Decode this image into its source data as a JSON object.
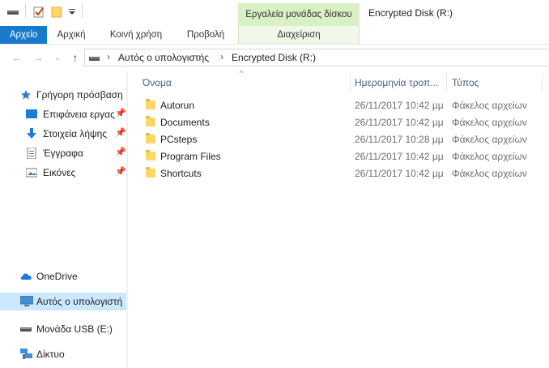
{
  "window": {
    "title": "Encrypted Disk (R:)",
    "contextual_tab_group": "Εργαλεία μονάδας δίσκου",
    "contextual_tab": "Διαχείριση"
  },
  "ribbon": {
    "tabs": [
      "Αρχείο",
      "Αρχική",
      "Κοινή χρήση",
      "Προβολή"
    ]
  },
  "address": {
    "breadcrumbs": [
      "Αυτός ο υπολογιστής",
      "Encrypted Disk (R:)"
    ],
    "separator": "›"
  },
  "nav_buttons": {
    "back": "←",
    "forward": "→",
    "recent": "⌄",
    "up": "↑"
  },
  "navigation": {
    "quick_access": {
      "label": "Γρήγορη πρόσβαση",
      "icon": "star-icon"
    },
    "pinned": [
      {
        "label": "Επιφάνεια εργας",
        "icon": "desktop-icon",
        "pin": "📌"
      },
      {
        "label": "Στοιχεία λήψης",
        "icon": "download-icon",
        "pin": "📌"
      },
      {
        "label": "Έγγραφα",
        "icon": "documents-icon",
        "pin": "📌"
      },
      {
        "label": "Εικόνες",
        "icon": "pictures-icon",
        "pin": "📌"
      }
    ],
    "onedrive": {
      "label": "OneDrive",
      "icon": "cloud-icon"
    },
    "this_pc": {
      "label": "Αυτός ο υπολογιστή",
      "icon": "computer-icon",
      "selected": true
    },
    "usb": {
      "label": "Μονάδα USB (E:)",
      "icon": "usb-drive-icon"
    },
    "network": {
      "label": "Δίκτυο",
      "icon": "network-icon"
    }
  },
  "columns": {
    "name": "Όνομα",
    "date": "Ημερομηνία τροπ...",
    "type": "Τύπος",
    "sort_indicator": "^"
  },
  "files": [
    {
      "name": "Autorun",
      "date": "26/11/2017 10:42 μμ",
      "type": "Φάκελος αρχείων"
    },
    {
      "name": "Documents",
      "date": "26/11/2017 10:42 μμ",
      "type": "Φάκελος αρχείων"
    },
    {
      "name": "PCsteps",
      "date": "26/11/2017 10:28 μμ",
      "type": "Φάκελος αρχείων"
    },
    {
      "name": "Program Files",
      "date": "26/11/2017 10:42 μμ",
      "type": "Φάκελος αρχείων"
    },
    {
      "name": "Shortcuts",
      "date": "26/11/2017 10:42 μμ",
      "type": "Φάκελος αρχείων"
    }
  ],
  "colors": {
    "file_tab": "#1979ca",
    "contextual_tab": "#d9efc4",
    "selected_nav": "#cce8ff",
    "folder": "#ffd766"
  }
}
